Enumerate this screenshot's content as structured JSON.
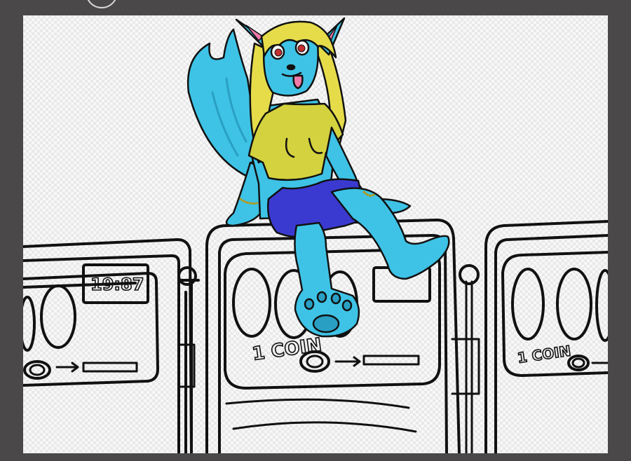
{
  "canvas": {
    "machine_center_label": "1 COIN",
    "machine_right_label": "1 COIN",
    "display_left_text": "19:87"
  },
  "colors": {
    "workspace_bg": "#4a4848",
    "fur": "#3ec3e6",
    "fur_shadow": "#2a9fc4",
    "hair": "#e6dc4a",
    "shirt": "#d4d23e",
    "shorts": "#3a3ad0",
    "tongue": "#f07aa8",
    "ink": "#111111"
  }
}
